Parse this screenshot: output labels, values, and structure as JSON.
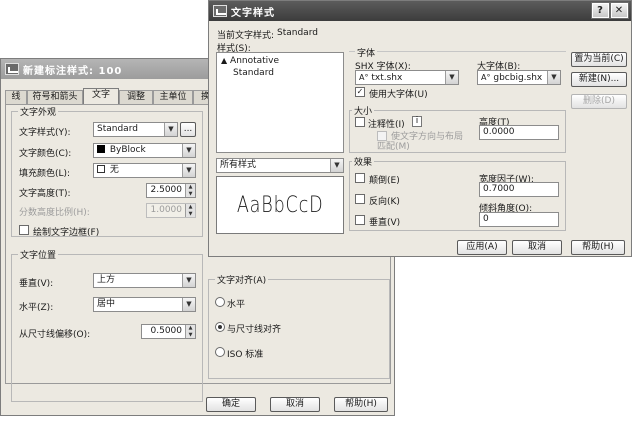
{
  "dim_dialog": {
    "title": "新建标注样式: 100",
    "tabs": [
      "线",
      "符号和箭头",
      "文字",
      "调整",
      "主单位",
      "换算"
    ],
    "appearance": {
      "title": "文字外观",
      "style_label": "文字样式(Y):",
      "style_value": "Standard",
      "style_more": "...",
      "color_label": "文字颜色(C):",
      "color_value": "ByBlock",
      "fill_label": "填充颜色(L):",
      "fill_value": "无",
      "height_label": "文字高度(T):",
      "height_value": "2.5000",
      "fraction_label": "分数高度比例(H):",
      "fraction_value": "1.0000",
      "frame_label": "绘制文字边框(F)"
    },
    "placement": {
      "title": "文字位置",
      "vertical_label": "垂直(V):",
      "vertical_value": "上方",
      "horizontal_label": "水平(Z):",
      "horizontal_value": "居中",
      "offset_label": "从尺寸线偏移(O):",
      "offset_value": "0.5000"
    },
    "alignment": {
      "title": "文字对齐(A)",
      "options": [
        "水平",
        "与尺寸线对齐",
        "ISO 标准"
      ],
      "selected_index": 1
    },
    "buttons": {
      "ok": "确定",
      "cancel": "取消",
      "help": "帮助(H)"
    }
  },
  "text_dialog": {
    "title": "文字样式",
    "help_btn": "?",
    "close_btn": "✕",
    "current_label": "当前文字样式:",
    "current_value": "Standard",
    "styles_label": "样式(S):",
    "styles": [
      {
        "name": "Annotative",
        "annotative": true
      },
      {
        "name": "Standard",
        "annotative": false
      }
    ],
    "filter_value": "所有样式",
    "preview_text": "AaBbCcD",
    "font": {
      "title": "字体",
      "shx_label": "SHX 字体(X):",
      "shx_value": "txt.shx",
      "big_label": "大字体(B):",
      "big_value": "gbcbig.shx",
      "use_big_label": "使用大字体(U)",
      "use_big_checked": true
    },
    "size": {
      "title": "大小",
      "annotative_label": "注释性(I)",
      "info_icon": "i",
      "match_label": "使文字方向与布局",
      "match_label_2": "匹配(M)",
      "height_label": "高度(T)",
      "height_value": "0.0000"
    },
    "effects": {
      "title": "效果",
      "upside_label": "颠倒(E)",
      "backwards_label": "反向(K)",
      "vertical_label": "垂直(V)",
      "width_label": "宽度因子(W):",
      "width_value": "0.7000",
      "oblique_label": "倾斜角度(O):",
      "oblique_value": "0"
    },
    "side_buttons": {
      "set_current": "置为当前(C)",
      "new": "新建(N)...",
      "delete": "删除(D)"
    },
    "buttons": {
      "apply": "应用(A)",
      "cancel": "取消",
      "help": "帮助(H)"
    }
  },
  "colors": {
    "title_dark": "#4a4a4a",
    "dialog_bg": "#ece9e1",
    "byblock_swatch": "#000000"
  }
}
